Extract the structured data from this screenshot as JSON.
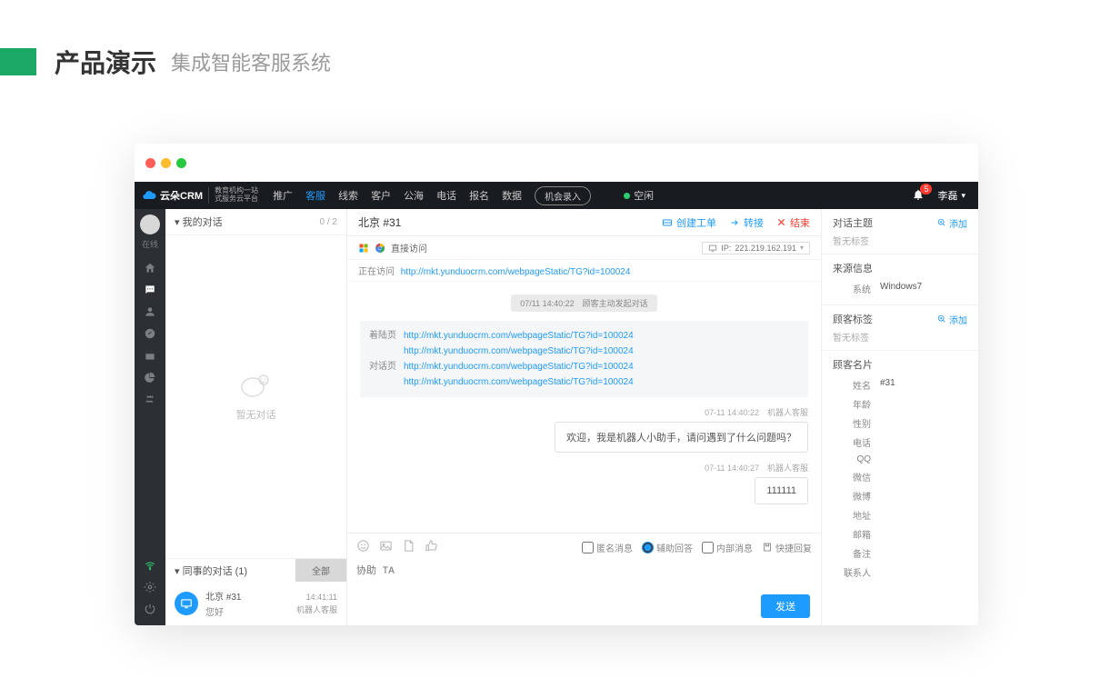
{
  "slide": {
    "title": "产品演示",
    "subtitle": "集成智能客服系统"
  },
  "topbar": {
    "brand": "云朵CRM",
    "brand_sub1": "教育机构一站",
    "brand_sub2": "式服务云平台",
    "nav": {
      "promote": "推广",
      "service": "客服",
      "clue": "线索",
      "customer": "客户",
      "sea": "公海",
      "phone": "电话",
      "signup": "报名",
      "data": "数据"
    },
    "record": "机会录入",
    "status": "空闲",
    "notif_count": "5",
    "user": "李磊"
  },
  "rail": {
    "online": "在线"
  },
  "convlist": {
    "my_title": "我的对话",
    "count": "0 / 2",
    "empty": "暂无对话",
    "colleague_title": "同事的对话  (1)",
    "all": "全部",
    "item": {
      "name": "北京 #31",
      "preview": "您好",
      "time": "14:41:11",
      "from": "机器人客服"
    }
  },
  "chat": {
    "title": "北京 #31",
    "create_ticket": "创建工单",
    "transfer": "转接",
    "end": "结束",
    "direct_visit": "直接访问",
    "ip": "221.219.162.191",
    "ip_label": "IP:",
    "visiting": "正在访问",
    "visiting_url": "http://mkt.yunduocrm.com/webpageStatic/TG?id=100024",
    "sys_pill": "07/11 14:40:22　顾客主动发起对话",
    "land_label": "着陆页",
    "land_url1": "http://mkt.yunduocrm.com/webpageStatic/TG?id=100024",
    "land_url2": "http://mkt.yunduocrm.com/webpageStatic/TG?id=100024",
    "talk_label": "对话页",
    "talk_url1": "http://mkt.yunduocrm.com/webpageStatic/TG?id=100024",
    "talk_url2": "http://mkt.yunduocrm.com/webpageStatic/TG?id=100024",
    "msg1_meta": "07-11 14:40:22　机器人客服",
    "msg1_text": "欢迎，我是机器人小助手，请问遇到了什么问题吗？",
    "msg2_meta": "07-11 14:40:27　机器人客服",
    "msg2_text": "111111",
    "opt_anon": "匿名消息",
    "opt_assist": "辅助回答",
    "opt_internal": "内部消息",
    "opt_quick": "快捷回复",
    "placeholder": "协助 TA",
    "send": "发送"
  },
  "side": {
    "topic": "对话主题",
    "add": "添加",
    "no_tag": "暂无标签",
    "source": "来源信息",
    "sys_k": "系统",
    "sys_v": "Windows7",
    "ctag": "顾客标签",
    "card": "顾客名片",
    "name_k": "姓名",
    "name_v": "#31",
    "age_k": "年龄",
    "sex_k": "性别",
    "phone_k": "电话",
    "qq_k": "QQ",
    "wechat_k": "微信",
    "weibo_k": "微博",
    "addr_k": "地址",
    "mail_k": "邮箱",
    "note_k": "备注",
    "contact_k": "联系人"
  }
}
